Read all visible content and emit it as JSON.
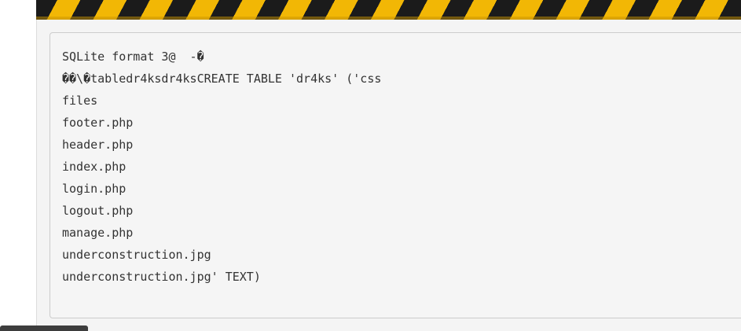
{
  "banner": {
    "icon": "hazard-stripes",
    "colors": {
      "stripe_dark": "#1b1b1b",
      "stripe_yellow": "#f2b705"
    }
  },
  "code_output": {
    "lines": [
      "SQLite format 3@  -�",
      "��\\�tabledr4ksdr4ksCREATE TABLE 'dr4ks' ('css",
      "files",
      "footer.php",
      "header.php",
      "index.php",
      "login.php",
      "logout.php",
      "manage.php",
      "underconstruction.jpg",
      "underconstruction.jpg' TEXT)"
    ]
  }
}
